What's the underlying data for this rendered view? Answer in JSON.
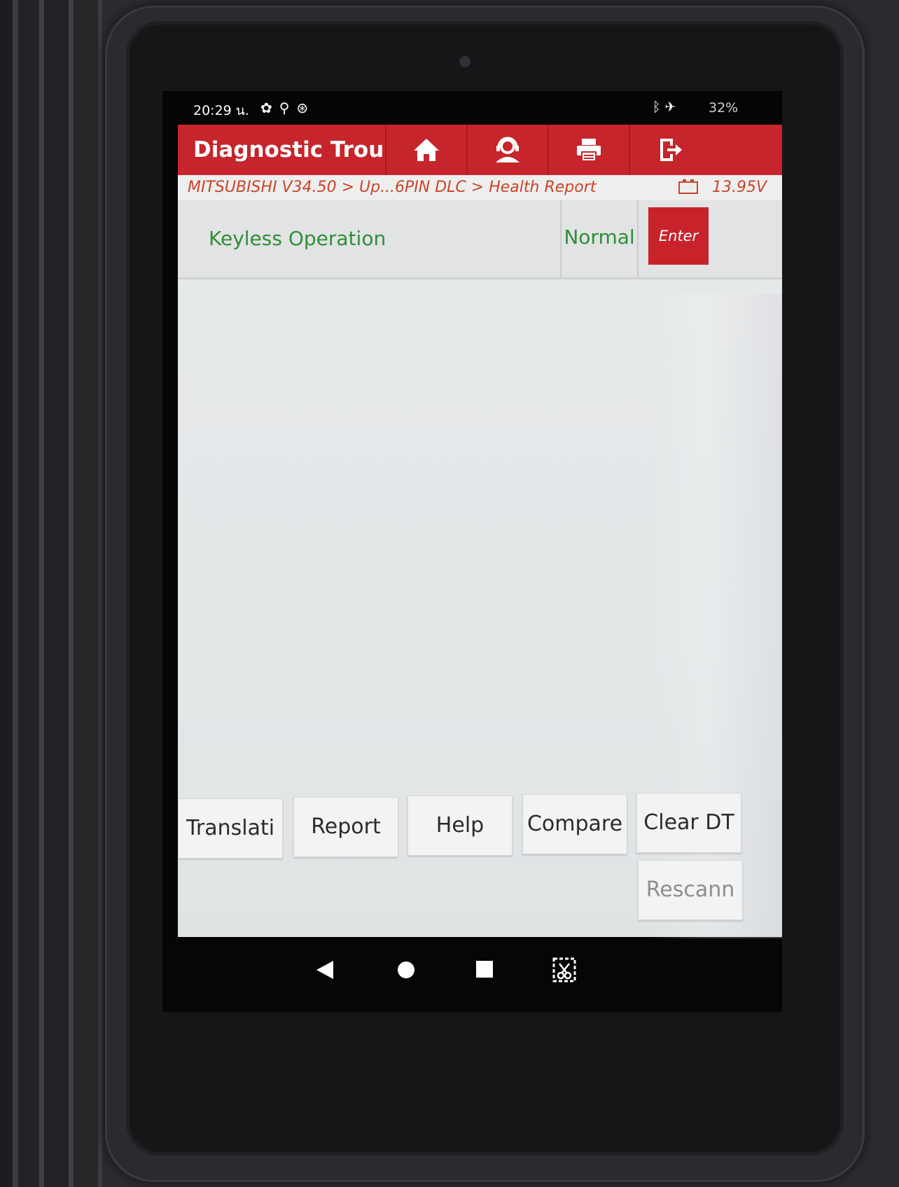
{
  "status_bar": {
    "time": "20:29 น.",
    "left_icons": [
      "settings-icon",
      "usb-icon",
      "sync-icon"
    ],
    "right_icons": [
      "bluetooth-icon",
      "airplane-icon"
    ],
    "battery": "32%"
  },
  "header": {
    "title": "Diagnostic Troul",
    "buttons": [
      "home-icon",
      "support-agent-icon",
      "printer-icon",
      "exit-icon"
    ]
  },
  "breadcrumb": {
    "path": "MITSUBISHI V34.50 > Up...6PIN DLC > Health Report",
    "voltage": "13.95V"
  },
  "report": {
    "rows": [
      {
        "name": "Keyless Operation",
        "status": "Normal",
        "action": "Enter"
      }
    ]
  },
  "toolbar": {
    "translation": "Translati",
    "report": "Report",
    "help": "Help",
    "compare": "Compare",
    "clear_dtc": "Clear DT",
    "rescan": "Rescann"
  },
  "colors": {
    "header_red": "#c6252b",
    "status_green": "#2f8f37",
    "breadcrumb_orange": "#c8452b"
  }
}
